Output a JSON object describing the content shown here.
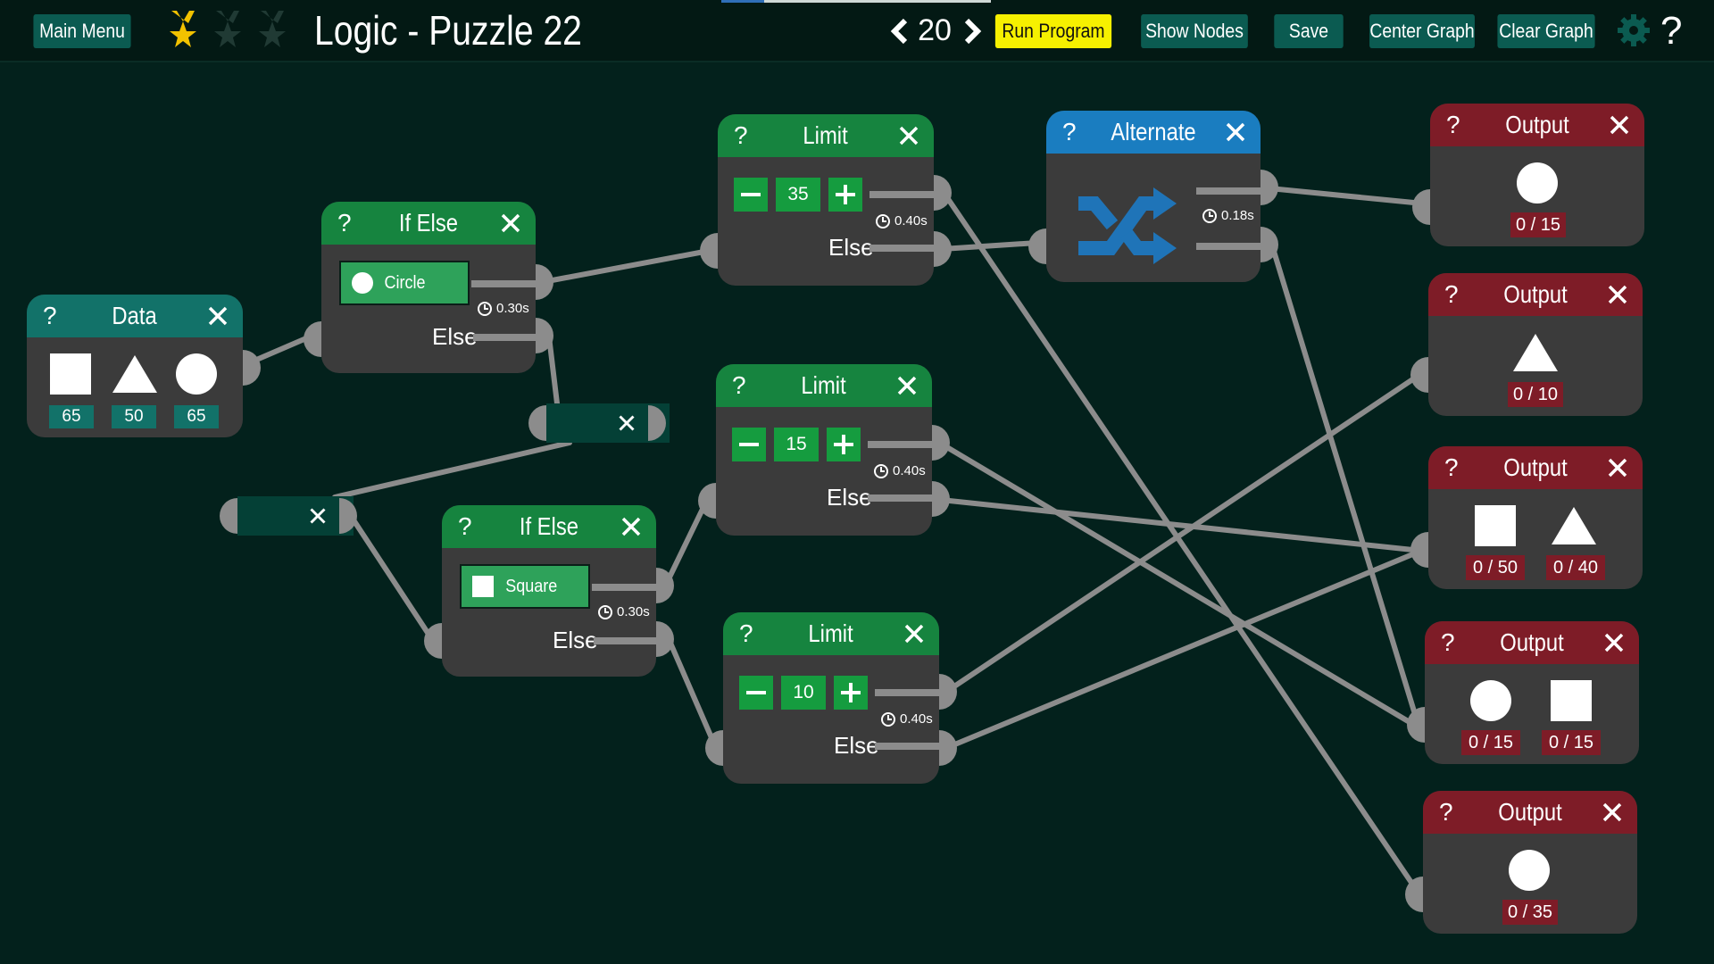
{
  "toolbar": {
    "main_menu": "Main Menu",
    "title": "Logic - Puzzle 22",
    "level": "20",
    "run_program": "Run Program",
    "show_nodes": "Show Nodes",
    "save": "Save",
    "center_graph": "Center Graph",
    "clear_graph": "Clear Graph",
    "help": "?",
    "stars_earned": 1,
    "stars_total": 3,
    "progress_fraction": 0.16
  },
  "colors": {
    "background": "#03211c",
    "data_header": "#127269",
    "logic_header": "#16843f",
    "alternate_header": "#1a7dc0",
    "output_header": "#7e1c27",
    "run_button": "#f6f000",
    "star_active": "#f2c200",
    "wire": "#8c8c8c"
  },
  "nodes": {
    "data": {
      "title": "Data",
      "help": "?",
      "items": [
        {
          "shape": "square",
          "value": "65"
        },
        {
          "shape": "triangle",
          "value": "50"
        },
        {
          "shape": "circle",
          "value": "65"
        }
      ]
    },
    "ifelse1": {
      "title": "If Else",
      "help": "?",
      "condition": "Circle",
      "condition_icon": "circle",
      "timer": "0.30s",
      "else": "Else"
    },
    "ifelse2": {
      "title": "If Else",
      "help": "?",
      "condition": "Square",
      "condition_icon": "square",
      "timer": "0.30s",
      "else": "Else"
    },
    "limit1": {
      "title": "Limit",
      "help": "?",
      "value": "35",
      "timer": "0.40s",
      "else": "Else"
    },
    "limit2": {
      "title": "Limit",
      "help": "?",
      "value": "15",
      "timer": "0.40s",
      "else": "Else"
    },
    "limit3": {
      "title": "Limit",
      "help": "?",
      "value": "10",
      "timer": "0.40s",
      "else": "Else"
    },
    "alternate": {
      "title": "Alternate",
      "help": "?",
      "timer": "0.18s",
      "icon": "shuffle-arrows-icon"
    },
    "output1": {
      "title": "Output",
      "help": "?",
      "items": [
        {
          "shape": "circle",
          "count": "0 / 15"
        }
      ]
    },
    "output2": {
      "title": "Output",
      "help": "?",
      "items": [
        {
          "shape": "triangle",
          "count": "0 / 10"
        }
      ]
    },
    "output3": {
      "title": "Output",
      "help": "?",
      "items": [
        {
          "shape": "square",
          "count": "0 / 50"
        },
        {
          "shape": "triangle",
          "count": "0 / 40"
        }
      ]
    },
    "output4": {
      "title": "Output",
      "help": "?",
      "items": [
        {
          "shape": "circle",
          "count": "0 / 15"
        },
        {
          "shape": "square",
          "count": "0 / 15"
        }
      ]
    },
    "output5": {
      "title": "Output",
      "help": "?",
      "items": [
        {
          "shape": "circle",
          "count": "0 / 35"
        }
      ]
    }
  }
}
